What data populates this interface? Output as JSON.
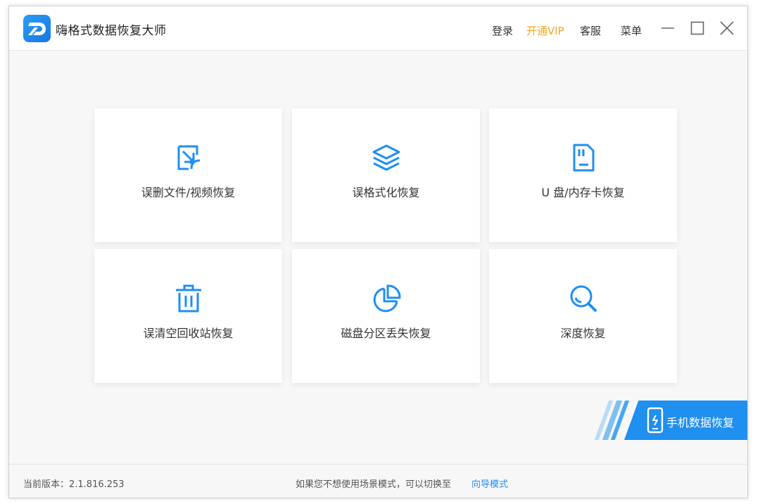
{
  "app": {
    "title": "嗨格式数据恢复大师"
  },
  "header": {
    "login": "登录",
    "vip": "开通VIP",
    "service": "客服",
    "menu": "菜单"
  },
  "cards": [
    {
      "label": "误删文件/视频恢复",
      "icon": "file-restore-icon"
    },
    {
      "label": "误格式化恢复",
      "icon": "layers-icon"
    },
    {
      "label": "U 盘/内存卡恢复",
      "icon": "sd-card-icon"
    },
    {
      "label": "误清空回收站恢复",
      "icon": "trash-icon"
    },
    {
      "label": "磁盘分区丢失恢复",
      "icon": "pie-chart-icon"
    },
    {
      "label": "深度恢复",
      "icon": "magnifier-icon"
    }
  ],
  "phone": {
    "label": "手机数据恢复"
  },
  "footer": {
    "version": "当前版本：2.1.816.253",
    "hint": "如果您不想使用场景模式，可以切换至",
    "guide": "向导模式"
  },
  "colors": {
    "accent": "#1f8ff0",
    "vip": "#f5a623",
    "background": "#f7f7f7"
  }
}
